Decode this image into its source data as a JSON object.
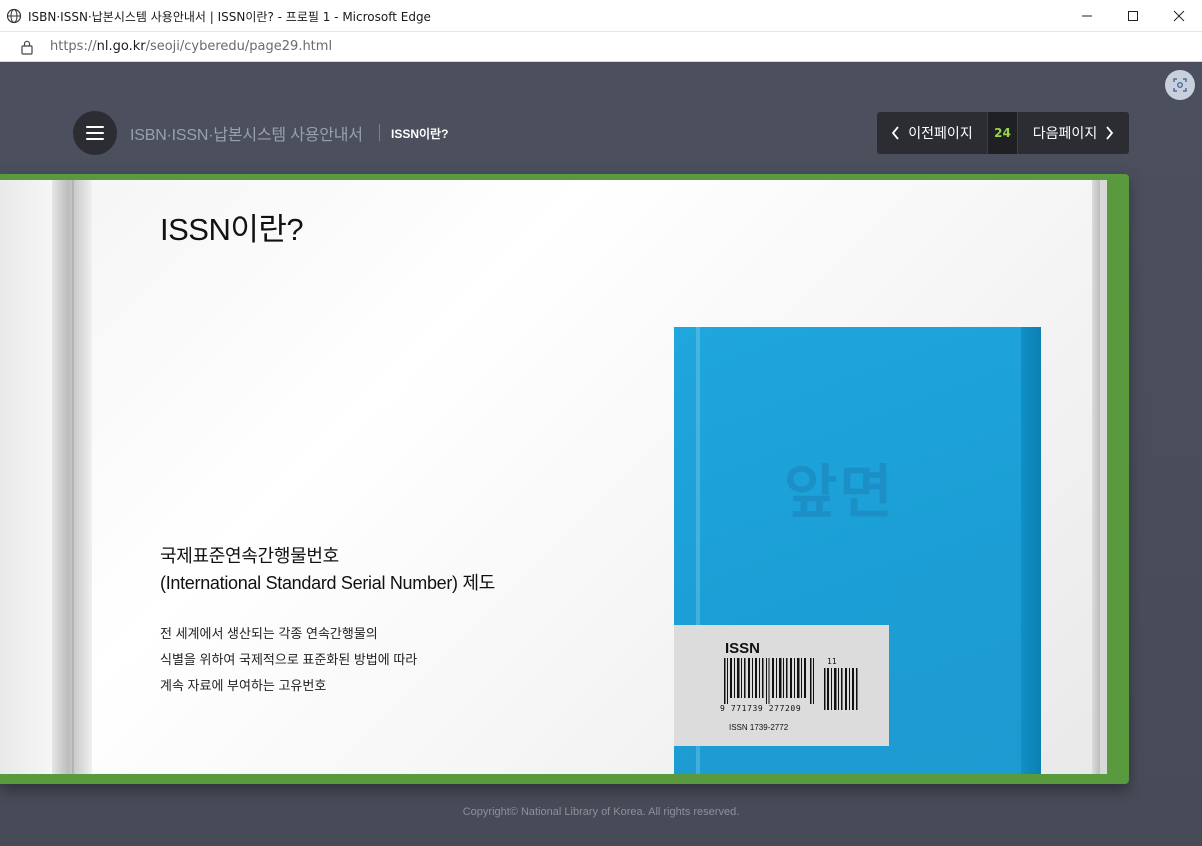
{
  "window": {
    "title": "ISBN·ISSN·납본시스템 사용안내서 | ISSN이란? - 프로필 1 - Microsoft Edge",
    "url_scheme": "https://",
    "url_host": "nl.go.kr",
    "url_path": "/seoji/cyberedu/page29.html",
    "icons": [
      "globe-icon",
      "minimize-icon",
      "maximize-icon",
      "close-icon",
      "lock-icon"
    ]
  },
  "header": {
    "site_title": "ISBN·ISSN·납본시스템 사용안내서",
    "section_title": "ISSN이란?",
    "menu_icon": "hamburger-icon",
    "screenshot_icon": "screenshot-icon"
  },
  "pager": {
    "prev_label": "이전페이지",
    "page_number": "24",
    "next_label": "다음페이지",
    "number_color": "#9bd34c"
  },
  "content": {
    "heading": "ISSN이란?",
    "lead_line1": "국제표준연속간행물번호",
    "lead_line2": "(International Standard Serial Number) 제도",
    "body_lines": [
      "전 세계에서 생산되는 각종 연속간행물의",
      "식별을 위하여 국제적으로 표준화된 방법에 따라",
      "계속 자료에 부여하는 고유번호"
    ]
  },
  "illustration": {
    "cover_text": "앞면",
    "label_title": "ISSN",
    "barcode_digits": "9 771739 277209",
    "addon_digits": "11",
    "issn_text": "ISSN  1739-2772",
    "cover_color": "#1fa6dc",
    "book_color": "#5a9a3e"
  },
  "footer": {
    "copyright": "Copyright© National Library of Korea. All rights reserved."
  }
}
